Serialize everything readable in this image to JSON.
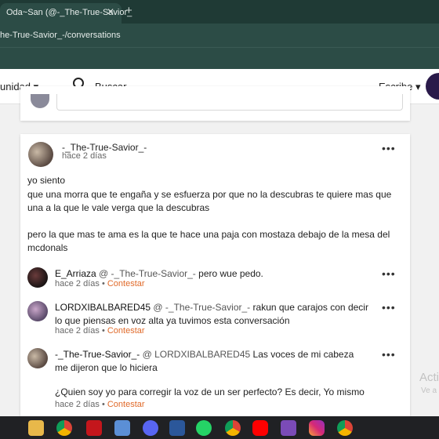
{
  "browser": {
    "tab_title": "Oda~San (@-_The-True-Savior_",
    "tab_close": "✕",
    "new_tab": "+",
    "url": "he-True-Savior_-/conversations"
  },
  "header": {
    "community_label": "unidad ▾",
    "search_label": "Buscar",
    "write_label": "Escribe ▾"
  },
  "post": {
    "author": "-_The-True-Savior_-",
    "time": "hace 2 días",
    "menu": "•••",
    "body": [
      "yo siento\nque una morra que te engaña y se esfuerza por que no la descubras te quiere mas que una a la que le vale verga que la descubras",
      "pero la que mas te ama es la que te hace una paja con mostaza debajo de la mesa del mcdonals"
    ]
  },
  "replies": [
    {
      "user": "E_Arriaza",
      "mention": "@ -_The-True-Savior_-",
      "text": "pero wue pedo.",
      "time": "hace 2 días",
      "sep": "•",
      "action": "Contestar",
      "menu": "•••"
    },
    {
      "user": "LORDXIBALBARED45",
      "mention": "@ -_The-True-Savior_-",
      "text": "rakun que carajos con decir lo que piensas en voz alta ya tuvimos esta conversación",
      "time": "hace 2 días",
      "sep": "•",
      "action": "Contestar",
      "menu": "•••"
    },
    {
      "user": "-_The-True-Savior_-",
      "mention": "@ LORDXIBALBARED45",
      "text": "Las voces de mi cabeza me dijeron que lo hiciera",
      "text2": "¿Quien soy yo para corregir la voz de un ser perfecto? Es decir, Yo mismo",
      "time": "hace 2 días",
      "sep": "•",
      "action": "Contestar",
      "menu": "•••"
    }
  ],
  "watermark": {
    "line1": "Acti",
    "line2": "Ve a"
  },
  "taskbar_icons": [
    "file-explorer-icon",
    "chrome-icon",
    "acrobat-icon",
    "app-icon",
    "discord-icon",
    "word-icon",
    "whatsapp-icon",
    "chrome-icon",
    "youtube-icon",
    "winrar-icon",
    "instagram-icon",
    "chrome-icon"
  ]
}
